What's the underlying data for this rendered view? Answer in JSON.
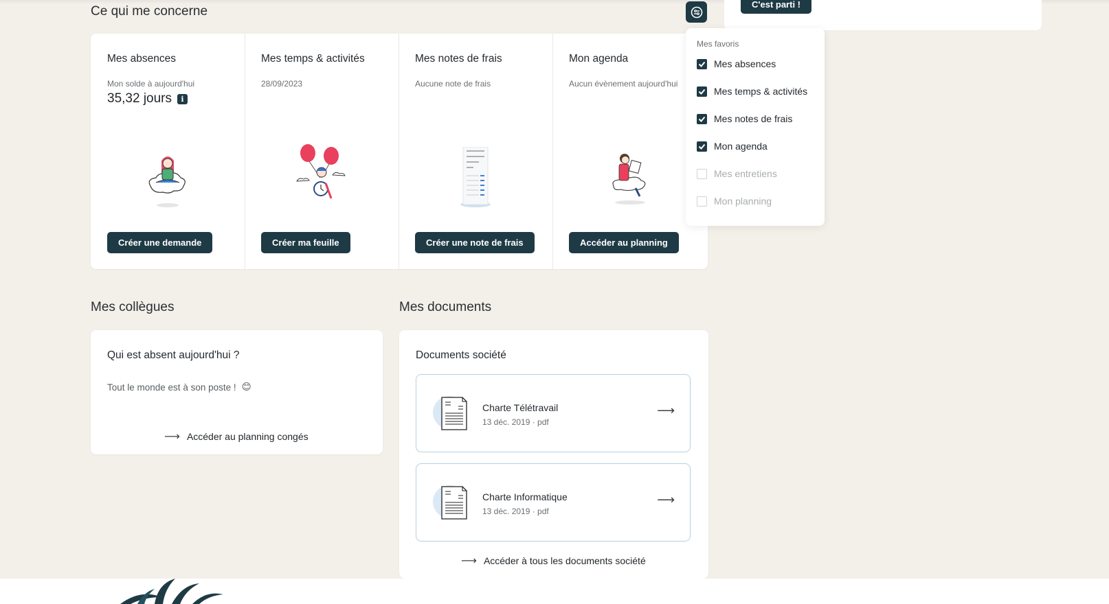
{
  "sections": {
    "concerne_title": "Ce qui me concerne",
    "collegues_title": "Mes collègues",
    "documents_title": "Mes documents"
  },
  "top_card": {
    "button_label": "C'est parti !"
  },
  "widgets": [
    {
      "title": "Mes absences",
      "subtitle": "Mon solde à aujourd'hui",
      "value": "35,32 jours",
      "button": "Créer une demande"
    },
    {
      "title": "Mes temps & activités",
      "subtitle": "28/09/2023",
      "button": "Créer ma feuille"
    },
    {
      "title": "Mes notes de frais",
      "subtitle": "Aucune note de frais",
      "button": "Créer une note de frais"
    },
    {
      "title": "Mon agenda",
      "subtitle": "Aucun évènement aujourd'hui",
      "button": "Accéder au planning"
    }
  ],
  "favorites_menu": {
    "header": "Mes favoris",
    "items": [
      {
        "label": "Mes absences",
        "checked": true,
        "enabled": true
      },
      {
        "label": "Mes temps & activités",
        "checked": true,
        "enabled": true
      },
      {
        "label": "Mes notes de frais",
        "checked": true,
        "enabled": true
      },
      {
        "label": "Mon agenda",
        "checked": true,
        "enabled": true
      },
      {
        "label": "Mes entretiens",
        "checked": false,
        "enabled": false
      },
      {
        "label": "Mon planning",
        "checked": false,
        "enabled": false
      }
    ]
  },
  "collegues": {
    "card_title": "Qui est absent aujourd'hui ?",
    "message": "Tout le monde est à son poste !",
    "emoji": "😊",
    "link": "Accéder au planning congés"
  },
  "documents": {
    "card_title": "Documents société",
    "items": [
      {
        "name": "Charte Télétravail",
        "meta": "13 déc. 2019 · pdf"
      },
      {
        "name": "Charte Informatique",
        "meta": "13 déc. 2019 · pdf"
      }
    ],
    "link": "Accéder à tous les documents société"
  },
  "colors": {
    "primary": "#1e3a45",
    "background": "#f3efe9",
    "doc_border": "#b6cfe0"
  },
  "icons": [
    "info-icon",
    "settings-icon",
    "checkbox-checked-icon",
    "arrow-right-icon",
    "document-icon",
    "plant-logo"
  ]
}
